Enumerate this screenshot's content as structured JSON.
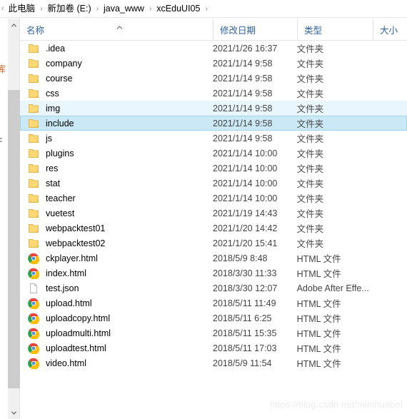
{
  "window": {
    "app": "File Explorer",
    "watermark": "https://blog.csdn.net/minihuabei"
  },
  "addressbar": {
    "lead_icon": "chevron-left-icon",
    "separator": "›",
    "crumbs": [
      {
        "label": "此电脑"
      },
      {
        "label": "新加卷 (E:)"
      },
      {
        "label": "java_www"
      },
      {
        "label": "xcEduUI05"
      }
    ]
  },
  "navigation_pane": {
    "clipped_text_1": "库",
    "clipped_text_2": "F"
  },
  "scrollbar": {
    "up_arrow_icon": "chevron-up-icon",
    "down_arrow_icon": "chevron-down-icon"
  },
  "columns": {
    "sort_indicator_icon": "sort-ascending-caret-icon",
    "headers": [
      {
        "key": "name",
        "label": "名称"
      },
      {
        "key": "date",
        "label": "修改日期"
      },
      {
        "key": "type",
        "label": "类型"
      },
      {
        "key": "size",
        "label": "大小"
      }
    ]
  },
  "files": [
    {
      "name": ".idea",
      "date": "2021/1/26 16:37",
      "type": "文件夹",
      "size": "",
      "icon": "folder-icon",
      "state": "normal"
    },
    {
      "name": "company",
      "date": "2021/1/14 9:58",
      "type": "文件夹",
      "size": "",
      "icon": "folder-icon",
      "state": "normal"
    },
    {
      "name": "course",
      "date": "2021/1/14 9:58",
      "type": "文件夹",
      "size": "",
      "icon": "folder-icon",
      "state": "normal"
    },
    {
      "name": "css",
      "date": "2021/1/14 9:58",
      "type": "文件夹",
      "size": "",
      "icon": "folder-icon",
      "state": "normal"
    },
    {
      "name": "img",
      "date": "2021/1/14 9:58",
      "type": "文件夹",
      "size": "",
      "icon": "folder-icon",
      "state": "hovered"
    },
    {
      "name": "include",
      "date": "2021/1/14 9:58",
      "type": "文件夹",
      "size": "",
      "icon": "folder-icon",
      "state": "selected"
    },
    {
      "name": "js",
      "date": "2021/1/14 9:58",
      "type": "文件夹",
      "size": "",
      "icon": "folder-icon",
      "state": "normal"
    },
    {
      "name": "plugins",
      "date": "2021/1/14 10:00",
      "type": "文件夹",
      "size": "",
      "icon": "folder-icon",
      "state": "normal"
    },
    {
      "name": "res",
      "date": "2021/1/14 10:00",
      "type": "文件夹",
      "size": "",
      "icon": "folder-icon",
      "state": "normal"
    },
    {
      "name": "stat",
      "date": "2021/1/14 10:00",
      "type": "文件夹",
      "size": "",
      "icon": "folder-icon",
      "state": "normal"
    },
    {
      "name": "teacher",
      "date": "2021/1/14 10:00",
      "type": "文件夹",
      "size": "",
      "icon": "folder-icon",
      "state": "normal"
    },
    {
      "name": "vuetest",
      "date": "2021/1/19 14:43",
      "type": "文件夹",
      "size": "",
      "icon": "folder-icon",
      "state": "normal"
    },
    {
      "name": "webpacktest01",
      "date": "2021/1/20 14:42",
      "type": "文件夹",
      "size": "",
      "icon": "folder-icon",
      "state": "normal"
    },
    {
      "name": "webpacktest02",
      "date": "2021/1/20 15:41",
      "type": "文件夹",
      "size": "",
      "icon": "folder-icon",
      "state": "normal"
    },
    {
      "name": "ckplayer.html",
      "date": "2018/5/9 8:48",
      "type": "HTML 文件",
      "size": "",
      "icon": "chrome-html-icon",
      "state": "normal"
    },
    {
      "name": "index.html",
      "date": "2018/3/30 11:33",
      "type": "HTML 文件",
      "size": "",
      "icon": "chrome-html-icon",
      "state": "normal"
    },
    {
      "name": "test.json",
      "date": "2018/3/30 12:07",
      "type": "Adobe After Effe...",
      "size": "",
      "icon": "generic-file-icon",
      "state": "normal"
    },
    {
      "name": "upload.html",
      "date": "2018/5/11 11:49",
      "type": "HTML 文件",
      "size": "",
      "icon": "chrome-html-icon",
      "state": "normal"
    },
    {
      "name": "uploadcopy.html",
      "date": "2018/5/11 6:25",
      "type": "HTML 文件",
      "size": "",
      "icon": "chrome-html-icon",
      "state": "normal"
    },
    {
      "name": "uploadmulti.html",
      "date": "2018/5/11 15:35",
      "type": "HTML 文件",
      "size": "",
      "icon": "chrome-html-icon",
      "state": "normal"
    },
    {
      "name": "uploadtest.html",
      "date": "2018/5/11 17:03",
      "type": "HTML 文件",
      "size": "",
      "icon": "chrome-html-icon",
      "state": "normal"
    },
    {
      "name": "video.html",
      "date": "2018/5/9 11:54",
      "type": "HTML 文件",
      "size": "",
      "icon": "chrome-html-icon",
      "state": "normal"
    }
  ],
  "colors": {
    "header_text": "#31629c",
    "folder_fill": "#ffd876",
    "selected_row": "#cbe8f6",
    "hover_row": "#eaf6fd",
    "scroll_thumb": "#cdcdcd",
    "watermark": "#ededed"
  }
}
